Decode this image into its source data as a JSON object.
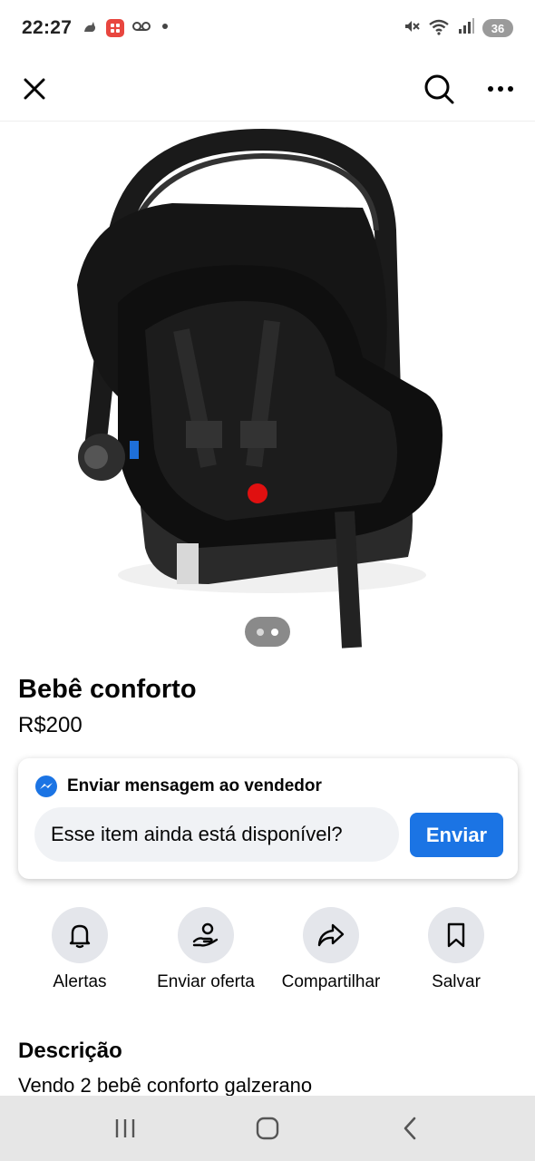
{
  "status_bar": {
    "time": "22:27",
    "battery": "36",
    "left_icons": [
      "cat-icon",
      "app-badge-icon",
      "voicemail-icon",
      "dot-icon"
    ],
    "right_icons": [
      "mute-icon",
      "wifi-icon",
      "signal-icon"
    ]
  },
  "top_bar": {
    "icons": [
      "close-icon",
      "search-icon",
      "more-icon"
    ]
  },
  "listing": {
    "title": "Bebê conforto",
    "price": "R$200",
    "photo_count": 2,
    "active_photo": 1
  },
  "message": {
    "header": "Enviar mensagem ao vendedor",
    "input_value": "Esse item ainda está disponível?",
    "send_label": "Enviar",
    "accent_color": "#1b74e4"
  },
  "actions": [
    {
      "label": "Alertas",
      "icon": "bell-icon"
    },
    {
      "label": "Enviar oferta",
      "icon": "offer-icon"
    },
    {
      "label": "Compartilhar",
      "icon": "share-icon"
    },
    {
      "label": "Salvar",
      "icon": "bookmark-icon"
    }
  ],
  "description": {
    "title": "Descrição",
    "text": "Vendo 2 bebê conforto galzerano"
  },
  "nav_bar": {
    "icons": [
      "recents-icon",
      "home-icon",
      "back-icon"
    ]
  }
}
